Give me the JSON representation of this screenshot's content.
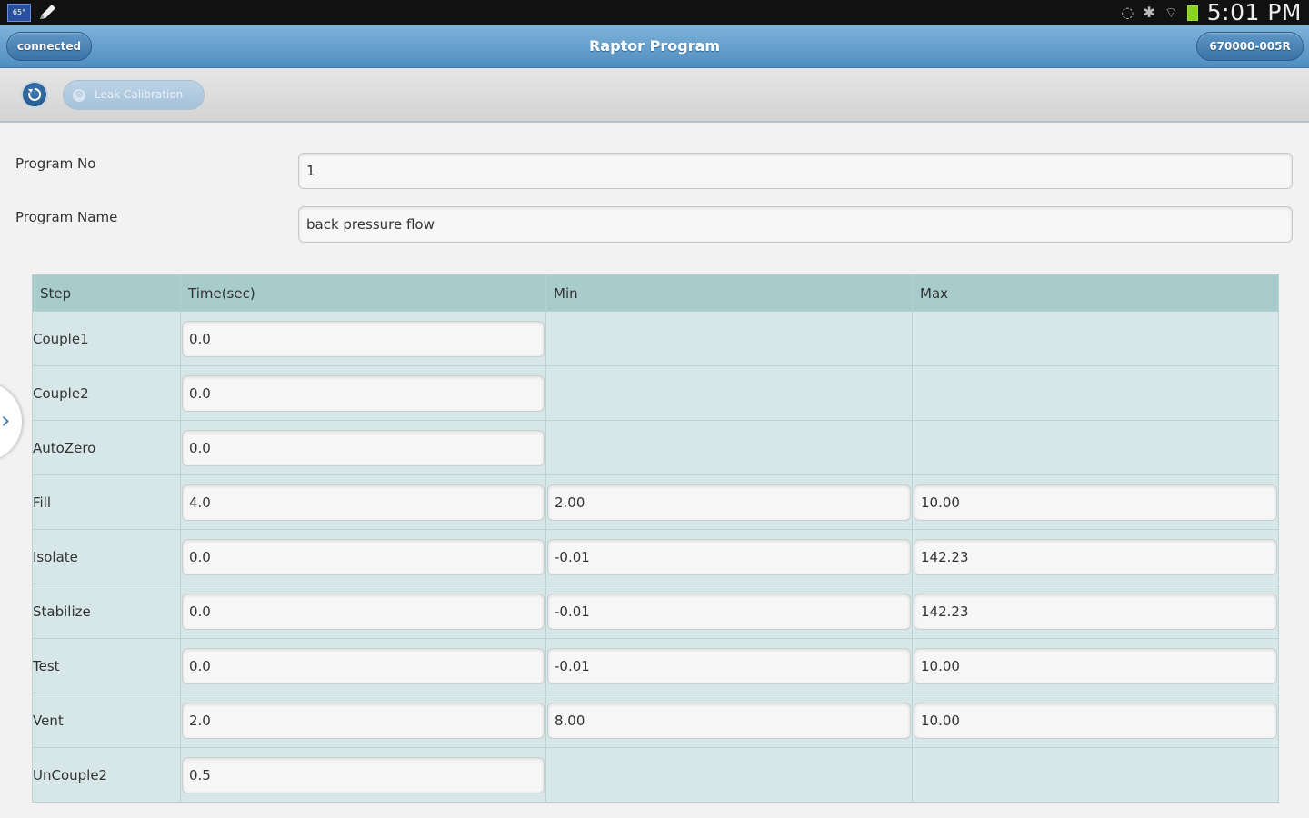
{
  "statusbar": {
    "time": "5:01 PM",
    "left_icon_text": "65°",
    "icons": [
      "notification-icon",
      "pencil-icon",
      "eye-icon",
      "bluetooth-icon",
      "wifi-icon",
      "battery-icon"
    ]
  },
  "header": {
    "left_button": "connected",
    "title": "Raptor Program",
    "right_button": "670000-005R"
  },
  "toolbar": {
    "calibration_label": "Leak Calibration"
  },
  "form": {
    "program_no_label": "Program No",
    "program_no_value": "1",
    "program_name_label": "Program Name",
    "program_name_value": "back pressure flow"
  },
  "table": {
    "headers": [
      "Step",
      "Time(sec)",
      "Min",
      "Max"
    ],
    "rows": [
      {
        "step": "Couple1",
        "time": "0.0",
        "min": null,
        "max": null
      },
      {
        "step": "Couple2",
        "time": "0.0",
        "min": null,
        "max": null
      },
      {
        "step": "AutoZero",
        "time": "0.0",
        "min": null,
        "max": null
      },
      {
        "step": "Fill",
        "time": "4.0",
        "min": "2.00",
        "max": "10.00"
      },
      {
        "step": "Isolate",
        "time": "0.0",
        "min": "-0.01",
        "max": "142.23"
      },
      {
        "step": "Stabilize",
        "time": "0.0",
        "min": "-0.01",
        "max": "142.23"
      },
      {
        "step": "Test",
        "time": "0.0",
        "min": "-0.01",
        "max": "10.00"
      },
      {
        "step": "Vent",
        "time": "2.0",
        "min": "8.00",
        "max": "10.00"
      },
      {
        "step": "UnCouple2",
        "time": "0.5",
        "min": null,
        "max": null
      }
    ]
  },
  "colors": {
    "header_blue": "#5f9acb",
    "table_header": "#a8cbcc",
    "table_body": "#d7e7e7",
    "accent_blue": "#3d7ab3"
  }
}
